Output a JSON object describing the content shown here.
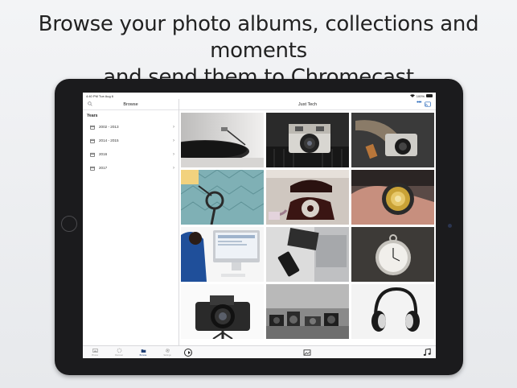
{
  "headline": {
    "line1": "Browse your photo albums, collections and moments",
    "line2": "and send them to Chromecast"
  },
  "status_bar": {
    "time": "4:40 PM  Tue Aug 6",
    "battery": "100%"
  },
  "sidebar": {
    "title": "Browse",
    "section_title": "Years",
    "items": [
      {
        "label": "2002 - 2013"
      },
      {
        "label": "2014 - 2015"
      },
      {
        "label": "2016"
      },
      {
        "label": "2017"
      }
    ]
  },
  "tabbar": {
    "tabs": [
      {
        "label": "Photos",
        "icon": "photos-icon",
        "active": false
      },
      {
        "label": "Discover",
        "icon": "discover-icon",
        "active": false
      },
      {
        "label": "Browse",
        "icon": "browse-icon",
        "active": true
      },
      {
        "label": "Settings",
        "icon": "gear-icon",
        "active": false
      }
    ]
  },
  "main": {
    "title": "Just Tech",
    "more_label": "•••"
  },
  "grid": {
    "tiles": [
      {
        "subject": "record player"
      },
      {
        "subject": "vintage camera on keyboard"
      },
      {
        "subject": "camera with strap"
      },
      {
        "subject": "lamp on patterned wall"
      },
      {
        "subject": "red rotary phone"
      },
      {
        "subject": "lens in hand"
      },
      {
        "subject": "person at imac"
      },
      {
        "subject": "notebook and phone on laptop"
      },
      {
        "subject": "pocket watch"
      },
      {
        "subject": "dslr camera"
      },
      {
        "subject": "camera shelf"
      },
      {
        "subject": "headphones"
      }
    ]
  },
  "colors": {
    "accent": "#1f62b8",
    "device": "#1b1b1d",
    "background": "#eceef1"
  }
}
